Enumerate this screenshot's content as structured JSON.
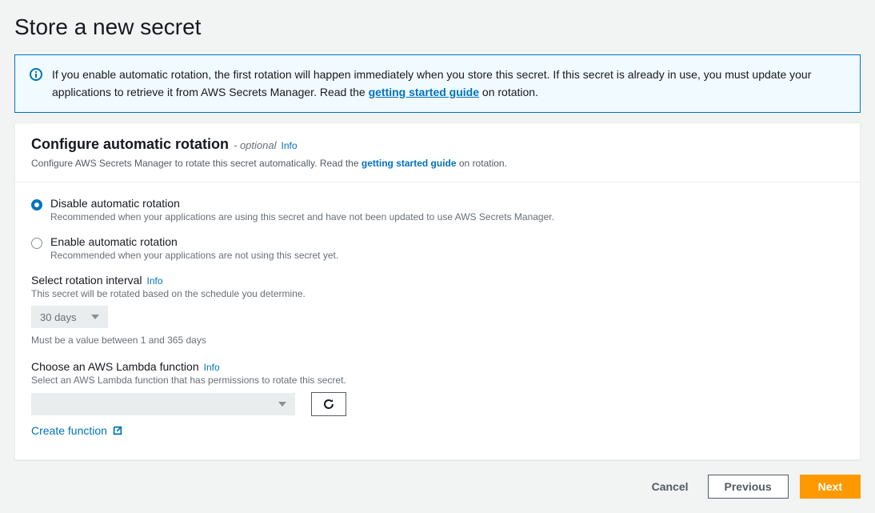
{
  "page": {
    "title": "Store a new secret"
  },
  "banner": {
    "text_prefix": "If you enable automatic rotation, the first rotation will happen immediately when you store this secret. If this secret is already in use, you must update your applications to retrieve it from AWS Secrets Manager. Read the ",
    "link_text": "getting started guide",
    "text_suffix": " on rotation."
  },
  "panel": {
    "title": "Configure automatic rotation",
    "optional": "- optional",
    "info_label": "Info",
    "sub_prefix": "Configure AWS Secrets Manager to rotate this secret automatically. Read the ",
    "sub_link": "getting started guide",
    "sub_suffix": " on rotation."
  },
  "radio_disable": {
    "label": "Disable automatic rotation",
    "desc": "Recommended when your applications are using this secret and have not been updated to use AWS Secrets Manager."
  },
  "radio_enable": {
    "label": "Enable automatic rotation",
    "desc": "Recommended when your applications are not using this secret yet."
  },
  "interval": {
    "label": "Select rotation interval",
    "info_label": "Info",
    "desc": "This secret will be rotated based on the schedule you determine.",
    "value": "30 days",
    "hint": "Must be a value between 1 and 365 days"
  },
  "lambda": {
    "label": "Choose an AWS Lambda function",
    "info_label": "Info",
    "desc": "Select an AWS Lambda function that has permissions to rotate this secret.",
    "create_link": "Create function"
  },
  "footer": {
    "cancel": "Cancel",
    "previous": "Previous",
    "next": "Next"
  }
}
